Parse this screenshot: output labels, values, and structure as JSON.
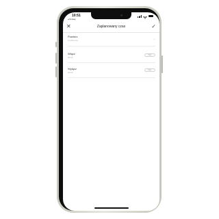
{
  "status_bar": {
    "time": "10:51",
    "back_label": "◂ Szukaj",
    "icons": [
      "signal-icon",
      "wifi-icon",
      "battery-icon"
    ]
  },
  "nav": {
    "title": "Zaplanowany czas",
    "close_icon": "close-icon",
    "confirm_icon": "check-icon"
  },
  "settings": {
    "rows": [
      {
        "label": "Powtórz",
        "value": "Codziennie",
        "control": "chevron"
      },
      {
        "label": "Włącz",
        "value": "00:00",
        "control": "toggle",
        "toggle_text": "Wył."
      },
      {
        "label": "Wyłącz",
        "value": "00:00",
        "control": "toggle",
        "toggle_text": "Wył."
      }
    ]
  },
  "colors": {
    "frame": "#d8d9cf",
    "bezel": "#0e0e0e",
    "screen": "#ffffff",
    "text": "#222222",
    "muted": "#b0b0b0"
  }
}
